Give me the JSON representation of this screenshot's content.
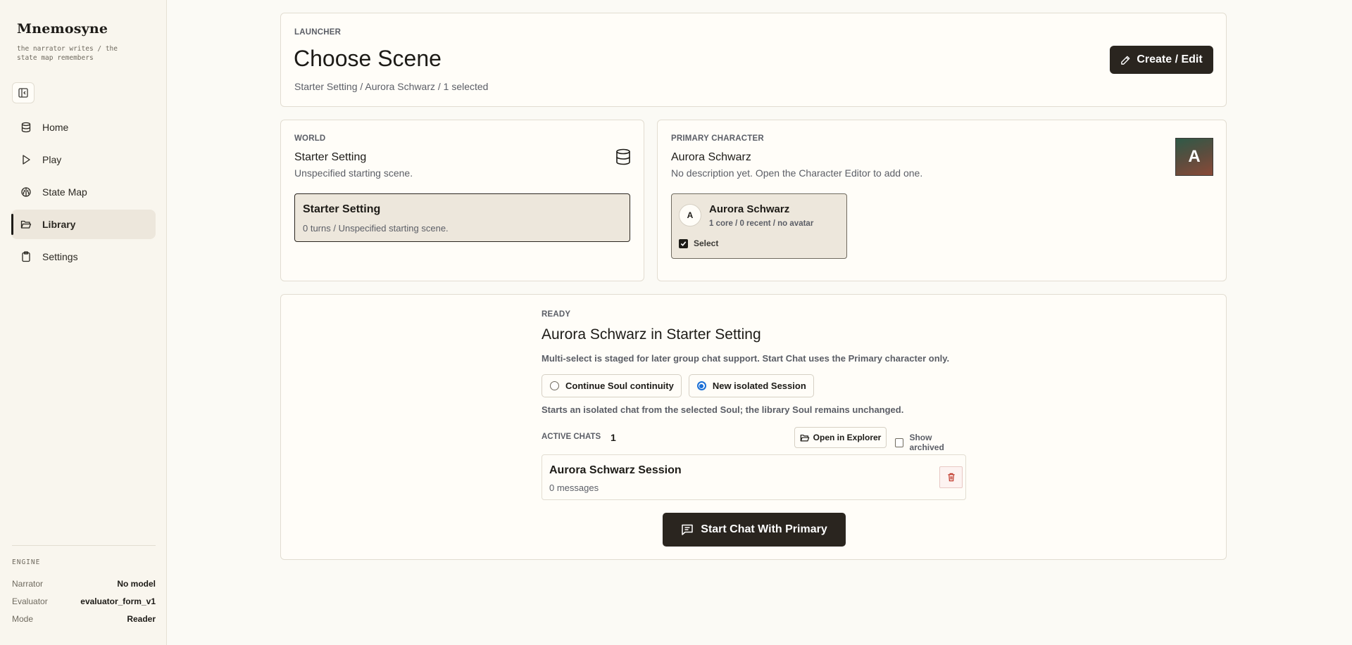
{
  "app": {
    "name": "Mnemosyne",
    "tagline": "the narrator writes / the state map remembers"
  },
  "sidebar": {
    "items": [
      {
        "label": "Home",
        "icon": "database-icon"
      },
      {
        "label": "Play",
        "icon": "play-icon"
      },
      {
        "label": "State Map",
        "icon": "brain-icon"
      },
      {
        "label": "Library",
        "icon": "folder-open-icon",
        "active": true
      },
      {
        "label": "Settings",
        "icon": "clipboard-icon"
      }
    ],
    "engine": {
      "title": "ENGINE",
      "rows": [
        {
          "key": "Narrator",
          "value": "No model"
        },
        {
          "key": "Evaluator",
          "value": "evaluator_form_v1"
        },
        {
          "key": "Mode",
          "value": "Reader"
        }
      ]
    }
  },
  "launcher": {
    "eyebrow": "LAUNCHER",
    "title": "Choose Scene",
    "subtitle": "Starter Setting / Aurora Schwarz / 1 selected",
    "create_label": "Create / Edit"
  },
  "world": {
    "eyebrow": "WORLD",
    "name": "Starter Setting",
    "description": "Unspecified starting scene.",
    "option": {
      "title": "Starter Setting",
      "meta": "0 turns / Unspecified starting scene."
    }
  },
  "primary": {
    "eyebrow": "PRIMARY CHARACTER",
    "name": "Aurora Schwarz",
    "description": "No description yet. Open the Character Editor to add one.",
    "avatar_letter": "A",
    "card": {
      "avatar_letter": "A",
      "name": "Aurora Schwarz",
      "meta": "1 core / 0 recent / no avatar",
      "select_label": "Select",
      "selected": true
    }
  },
  "ready": {
    "eyebrow": "READY",
    "title": "Aurora Schwarz in Starter Setting",
    "note": "Multi-select is staged for later group chat support. Start Chat uses the Primary character only.",
    "modes": [
      {
        "label": "Continue Soul continuity",
        "selected": false
      },
      {
        "label": "New isolated Session",
        "selected": true
      }
    ],
    "mode_note": "Starts an isolated chat from the selected Soul; the library Soul remains unchanged.",
    "active_chats_label": "ACTIVE CHATS",
    "active_chats_count": "1",
    "open_explorer_label": "Open in Explorer",
    "show_archived_label": "Show archived",
    "session": {
      "title": "Aurora Schwarz Session",
      "meta": "0 messages"
    },
    "start_label": "Start Chat With Primary"
  },
  "colors": {
    "accent_dark": "#2a251f",
    "background": "#fbfaf5",
    "radio_blue": "#1a6fd6"
  }
}
